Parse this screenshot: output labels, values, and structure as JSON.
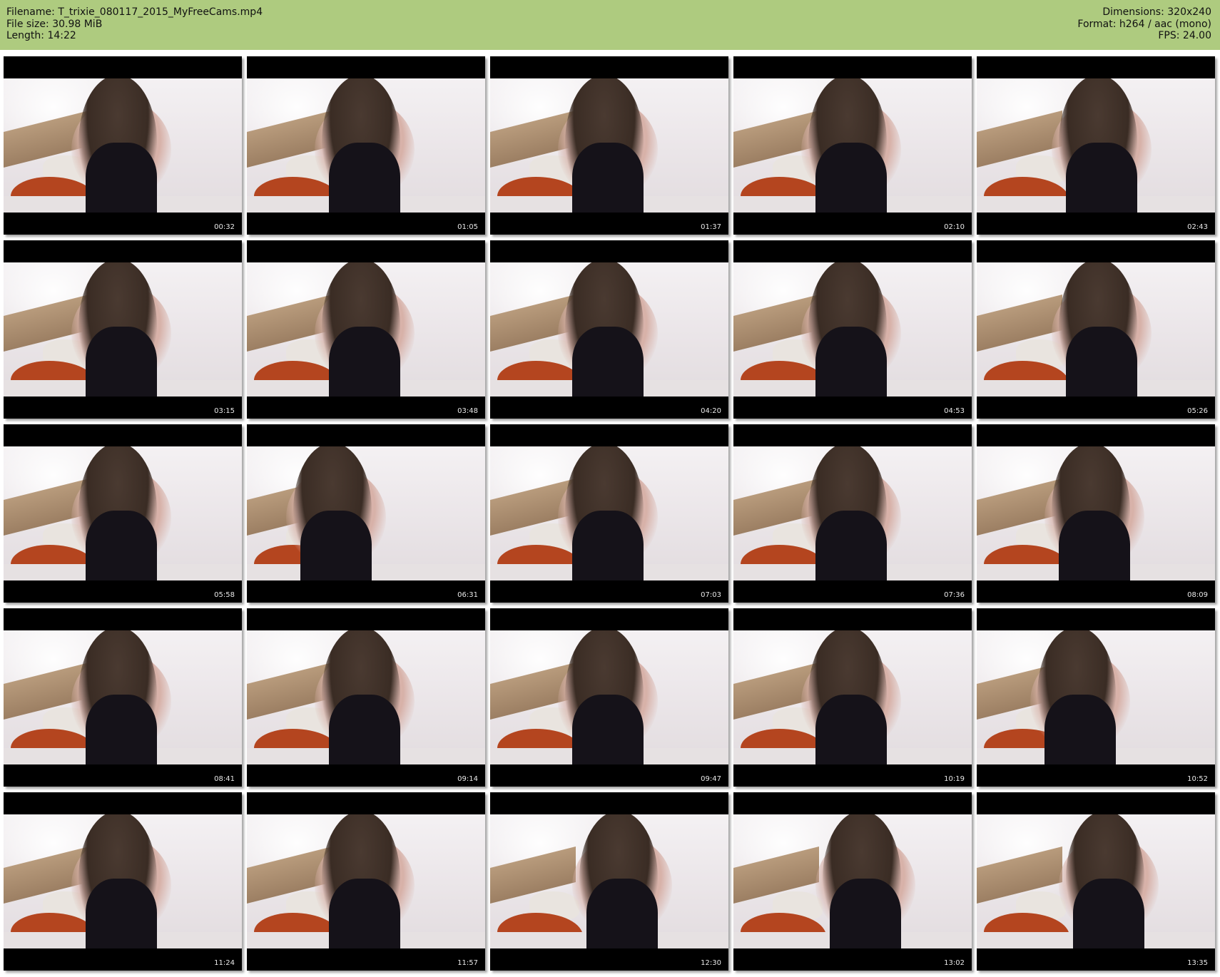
{
  "header": {
    "filename_label": "Filename:",
    "filename": "T_trixie_080117_2015_MyFreeCams.mp4",
    "filesize_label": "File size:",
    "filesize": "30.98 MiB",
    "length_label": "Length:",
    "length": "14:22",
    "dimensions_label": "Dimensions:",
    "dimensions": "320x240",
    "format_label": "Format:",
    "format": "h264 / aac (mono)",
    "fps_label": "FPS:",
    "fps": "24.00"
  },
  "colors": {
    "header_bg": "#aecb7f",
    "thumb_bg": "#000000"
  },
  "thumbnails": [
    {
      "time": "00:32"
    },
    {
      "time": "01:05"
    },
    {
      "time": "01:37"
    },
    {
      "time": "02:10"
    },
    {
      "time": "02:43"
    },
    {
      "time": "03:15"
    },
    {
      "time": "03:48"
    },
    {
      "time": "04:20"
    },
    {
      "time": "04:53"
    },
    {
      "time": "05:26"
    },
    {
      "time": "05:58"
    },
    {
      "time": "06:31"
    },
    {
      "time": "07:03"
    },
    {
      "time": "07:36"
    },
    {
      "time": "08:09"
    },
    {
      "time": "08:41"
    },
    {
      "time": "09:14"
    },
    {
      "time": "09:47"
    },
    {
      "time": "10:19"
    },
    {
      "time": "10:52"
    },
    {
      "time": "11:24"
    },
    {
      "time": "11:57"
    },
    {
      "time": "12:30"
    },
    {
      "time": "13:02"
    },
    {
      "time": "13:35"
    }
  ]
}
